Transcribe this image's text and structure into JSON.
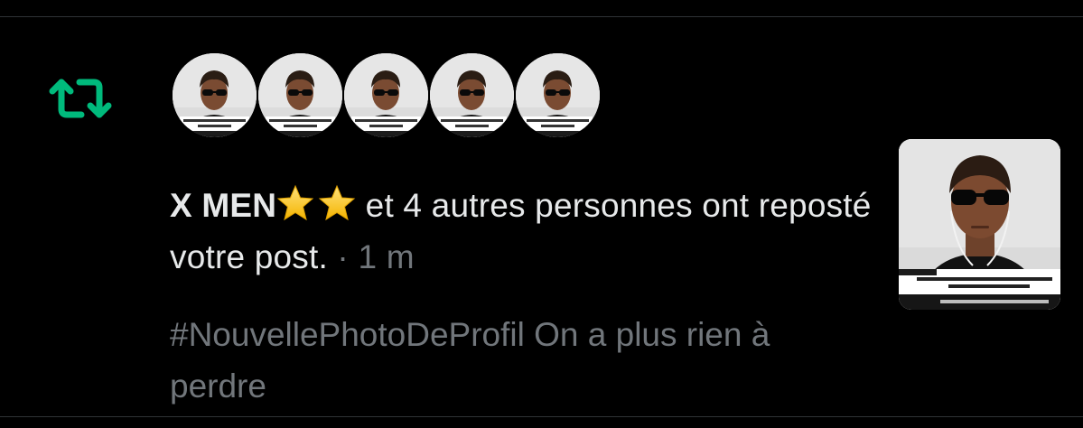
{
  "notification": {
    "type": "repost",
    "icon": "repost-icon",
    "accent_color": "#00ba7c",
    "avatars": [
      {
        "icon": "avatar-portrait"
      },
      {
        "icon": "avatar-portrait"
      },
      {
        "icon": "avatar-portrait"
      },
      {
        "icon": "avatar-portrait"
      },
      {
        "icon": "avatar-portrait"
      }
    ],
    "actor_name": "X MEN",
    "actor_emojis": [
      "star-icon",
      "star-icon"
    ],
    "message": " et 4 autres personnes ont reposté votre post.",
    "separator": " · ",
    "time": "1 m",
    "post_text": "#NouvellePhotoDeProfil On a plus rien à perdre",
    "thumbnail": {
      "icon": "post-photo"
    }
  }
}
